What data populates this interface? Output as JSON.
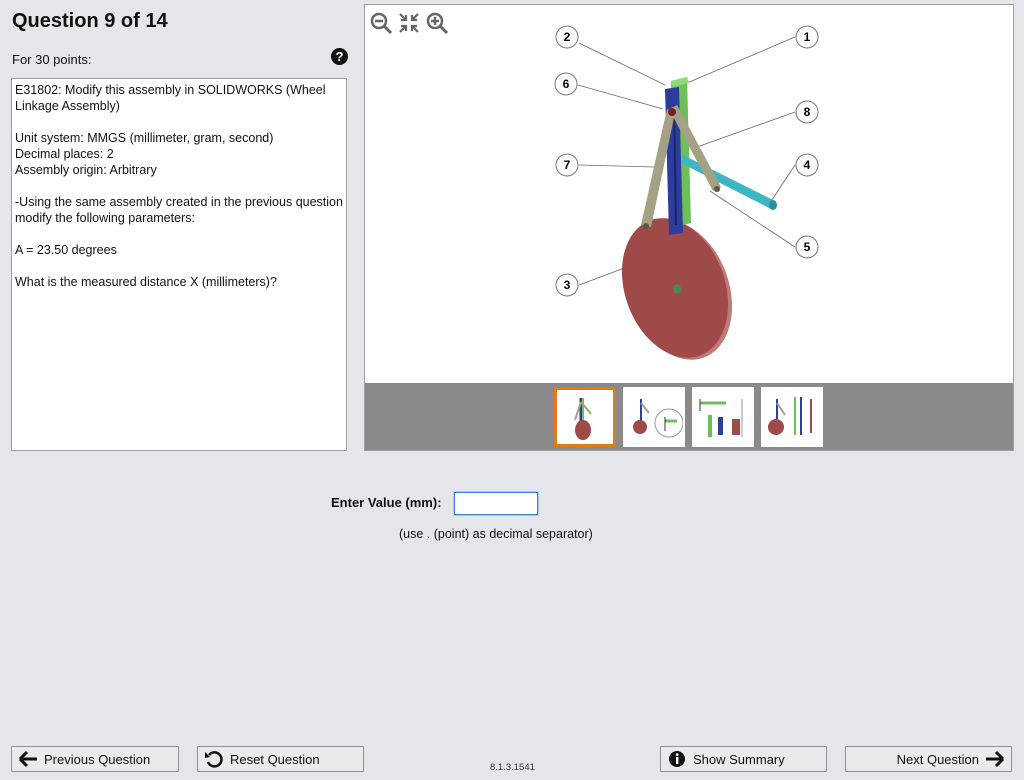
{
  "header": {
    "question_title": "Question 9 of 14",
    "points": "For 30 points:"
  },
  "question": {
    "line1": "E31802:  Modify this assembly in SOLIDWORKS (Wheel Linkage Assembly)",
    "unit_system": "Unit system: MMGS (millimeter, gram, second)",
    "decimal_places": "Decimal places: 2",
    "assembly_origin": "Assembly origin: Arbitrary",
    "instruction": "-Using the same assembly created in the previous question modify the following parameters:",
    "parameter": "A = 23.50 degrees",
    "prompt": "What is the measured distance X (millimeters)?"
  },
  "diagram": {
    "callouts": [
      "1",
      "2",
      "3",
      "4",
      "5",
      "6",
      "7",
      "8"
    ],
    "colors": {
      "green_bar": "#6dbf5a",
      "blue_bar": "#2e3d9c",
      "link": "#a5a185",
      "wheel": "#9e4a48",
      "axle": "#3fb5c4"
    }
  },
  "thumbnails": {
    "selected_index": 0,
    "count": 4,
    "accent": "#e07b18"
  },
  "answer": {
    "label": "Enter Value (mm):",
    "value": "",
    "hint": "(use . (point) as decimal separator)"
  },
  "footer": {
    "previous": "Previous Question",
    "reset": "Reset Question",
    "version": "8.1.3.1541",
    "summary": "Show Summary",
    "next": "Next Question"
  }
}
